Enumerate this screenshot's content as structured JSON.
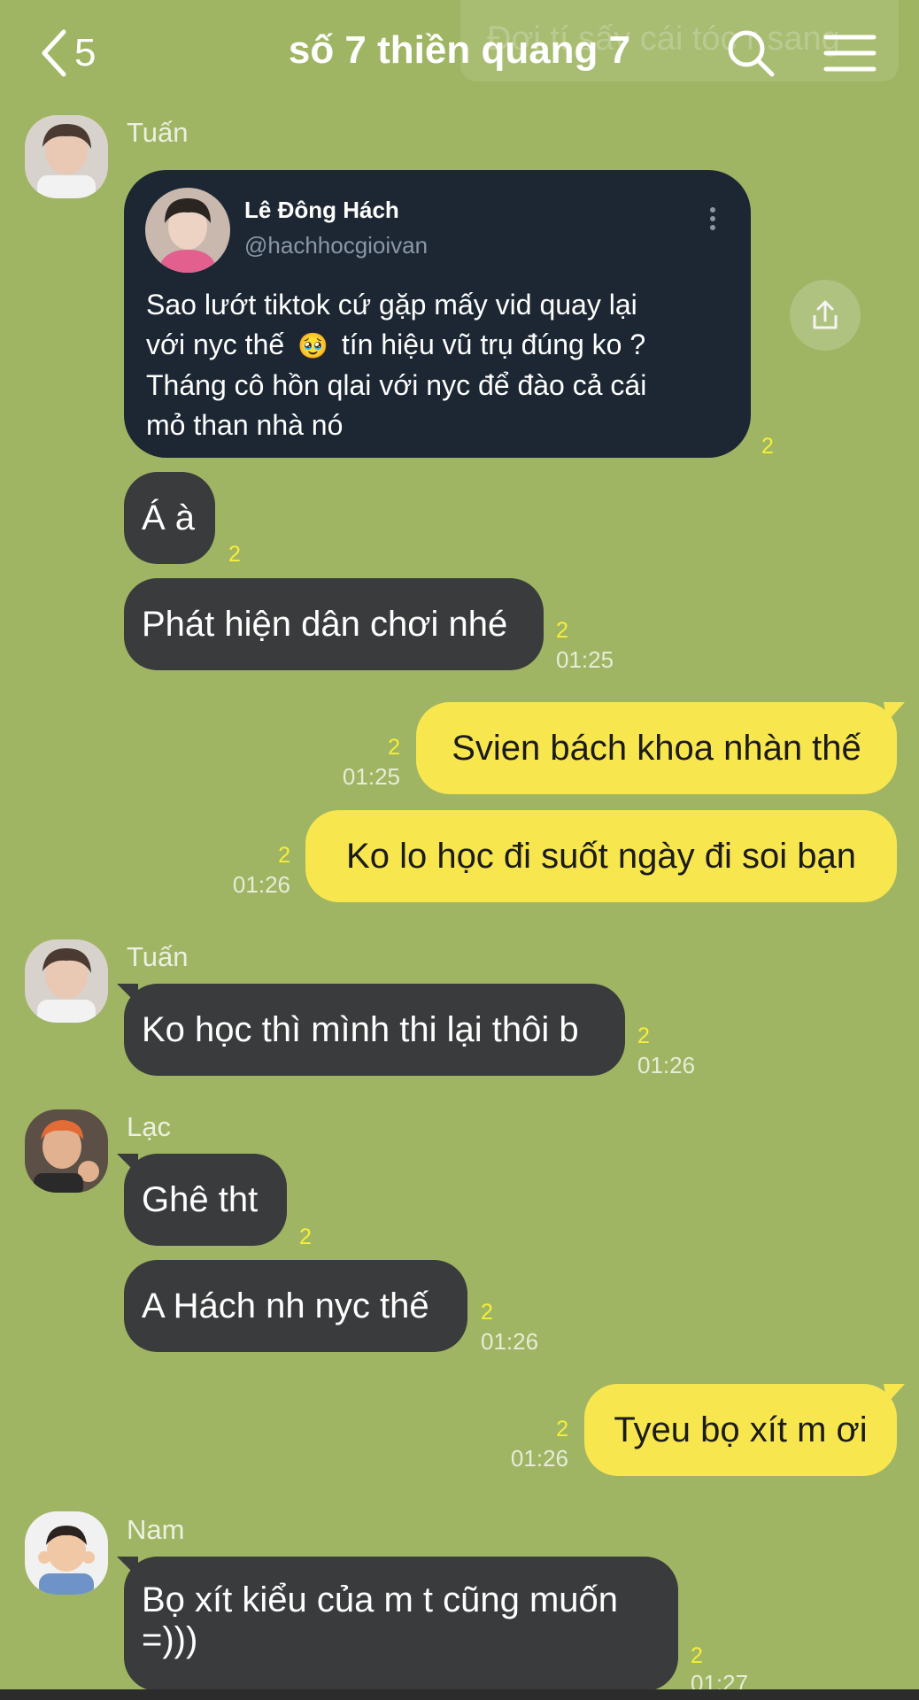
{
  "header": {
    "title": "số 7 thiền quang 7",
    "back_count": "5",
    "ghost_notification": "Đợi tí sấy cái tóc r sang"
  },
  "senders": {
    "tuan": "Tuấn",
    "lac": "Lạc",
    "nam": "Nam"
  },
  "shared_post": {
    "author": "Lê Đông Hách",
    "handle": "@hachhocgioivan",
    "text_line1": "Sao lướt tiktok cứ gặp mấy vid quay lại",
    "text_line2_a": "với nyc thế",
    "emoji": "🥹",
    "text_line2_b": "tín hiệu vũ trụ đúng ko ?",
    "text_line3": "Tháng cô hồn qlai với nyc để đào cả cái",
    "text_line4": "mỏ than nhà nó",
    "unread": "2"
  },
  "messages": [
    {
      "text": "Á à",
      "unread": "2",
      "time": ""
    },
    {
      "text": "Phát hiện dân chơi nhé",
      "unread": "2",
      "time": "01:25"
    },
    {
      "text": "Svien bách khoa nhàn thế",
      "unread": "2",
      "time": "01:25"
    },
    {
      "text": "Ko lo học đi suốt ngày đi soi bạn",
      "unread": "2",
      "time": "01:26"
    },
    {
      "text": "Ko học thì mình thi lại thôi b",
      "unread": "2",
      "time": "01:26"
    },
    {
      "text": "Ghê tht",
      "unread": "2",
      "time": ""
    },
    {
      "text": "A Hách nh nyc thế",
      "unread": "2",
      "time": "01:26"
    },
    {
      "text": "Tyeu bọ xít m ơi",
      "unread": "2",
      "time": "01:26"
    },
    {
      "text_line1": "Bọ xít kiểu của m t cũng muốn",
      "text_line2": "=)))",
      "unread": "2",
      "time": "01:27"
    }
  ],
  "colors": {
    "background": "#9fb563",
    "incoming_bubble": "#3a3b3c",
    "outgoing_bubble": "#f8e64f",
    "unread_count": "#f7ee3a",
    "card_background": "#1c2733"
  },
  "icons": [
    "chevron-left-icon",
    "search-icon",
    "menu-icon",
    "share-icon",
    "more-vertical-icon"
  ]
}
